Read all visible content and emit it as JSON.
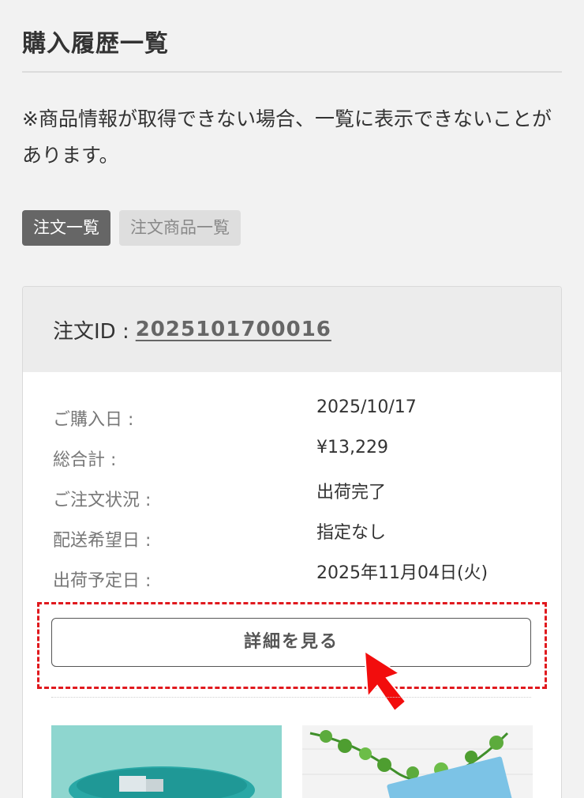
{
  "page": {
    "title": "購入履歴一覧",
    "notice": "※商品情報が取得できない場合、一覧に表示できないことがあります。"
  },
  "tabs": [
    {
      "label": "注文一覧",
      "active": true
    },
    {
      "label": "注文商品一覧",
      "active": false
    }
  ],
  "order": {
    "id_label": "注文ID : ",
    "id_value": "2025101700016",
    "rows": [
      {
        "label": "ご購入日 :",
        "value": "2025/10/17"
      },
      {
        "label": "総合計 :",
        "value": "¥13,229"
      },
      {
        "label": "ご注文状況 :",
        "value": "出荷完了"
      },
      {
        "label": "配送希望日 :",
        "value": "指定なし"
      },
      {
        "label": "出荷予定日 :",
        "value": "2025年11月04日(火)"
      }
    ],
    "detail_button_label": "詳細を見る"
  },
  "colors": {
    "highlight": "#e0191e",
    "tab_active_bg": "#666666",
    "tab_inactive_bg": "#dedede",
    "thumb_teal": "#8ed6cf"
  },
  "icons": {
    "pointer": "red-arrow-icon"
  }
}
